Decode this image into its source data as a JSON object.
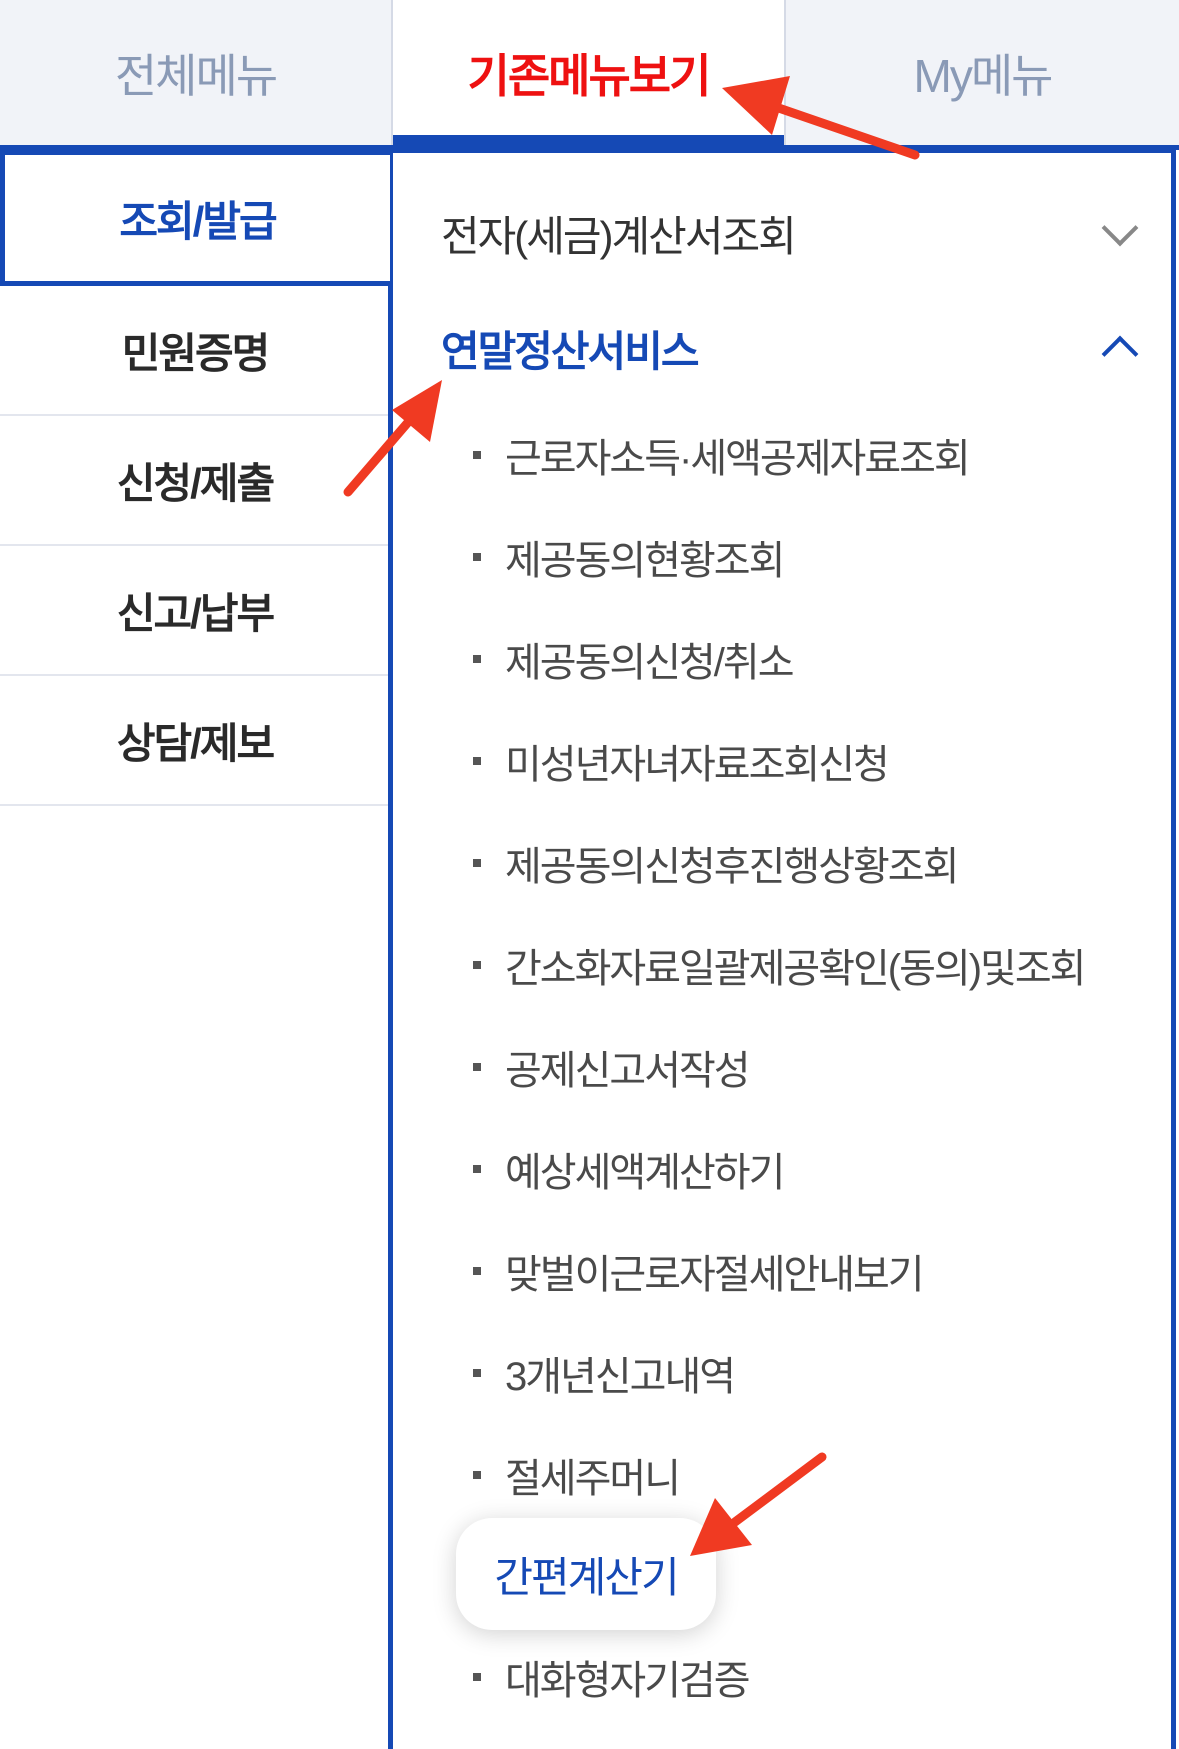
{
  "tabs": {
    "all_menu": "전체메뉴",
    "classic_menu": "기존메뉴보기",
    "my_menu": "My메뉴"
  },
  "categories": [
    "조회/발급",
    "민원증명",
    "신청/제출",
    "신고/납부",
    "상담/제보"
  ],
  "sections": {
    "einvoice": "전자(세금)계산서조회",
    "yearend": "연말정산서비스"
  },
  "items": [
    "근로자소득·세액공제자료조회",
    "제공동의현황조회",
    "제공동의신청/취소",
    "미성년자녀자료조회신청",
    "제공동의신청후진행상황조회",
    "간소화자료일괄제공확인(동의)및조회",
    "공제신고서작성",
    "예상세액계산하기",
    "맞벌이근로자절세안내보기",
    "3개년신고내역",
    "절세주머니"
  ],
  "highlighted_item": "간편계산기",
  "last_item": "대화형자기검증",
  "colors": {
    "accent": "#1549b5",
    "active_tab": "#ee1111",
    "arrow": "#f03a22"
  }
}
